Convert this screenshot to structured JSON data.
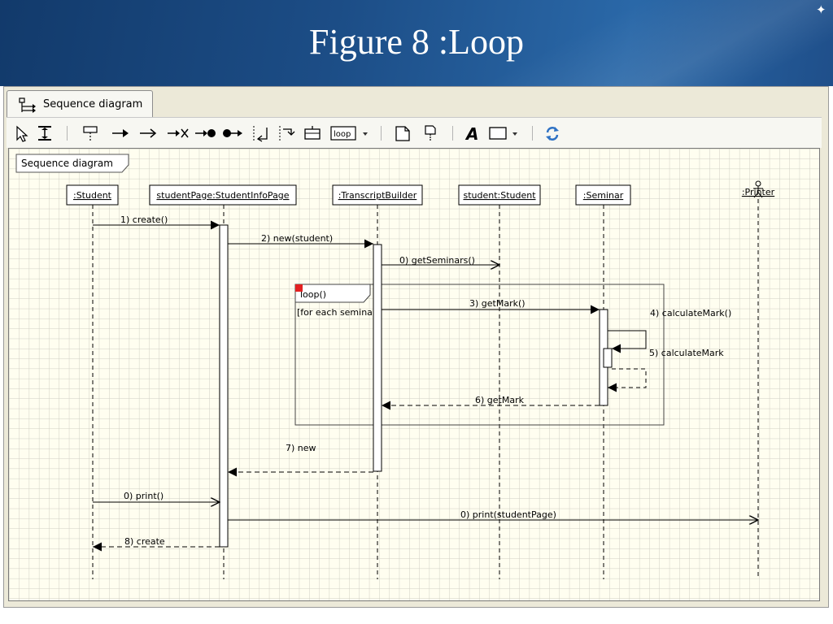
{
  "slide": {
    "title": "Figure 8 :Loop"
  },
  "tab": {
    "label": "Sequence diagram"
  },
  "toolbar": {
    "loop_label": "loop"
  },
  "diagram": {
    "frame_label": "Sequence diagram",
    "lifelines": [
      ":Student",
      "studentPage:StudentInfoPage",
      ":TranscriptBuilder",
      "student:Student",
      ":Seminar",
      ":Printer"
    ],
    "fragment_label": "loop()",
    "guard": "[for each seminar]",
    "messages": [
      "1) create()",
      "2) new(student)",
      "0) getSeminars()",
      "3) getMark()",
      "4) calculateMark()",
      "5) calculateMark",
      "6) getMark",
      "7) new",
      "0) print()",
      "0) print(studentPage)",
      "8) create"
    ]
  }
}
